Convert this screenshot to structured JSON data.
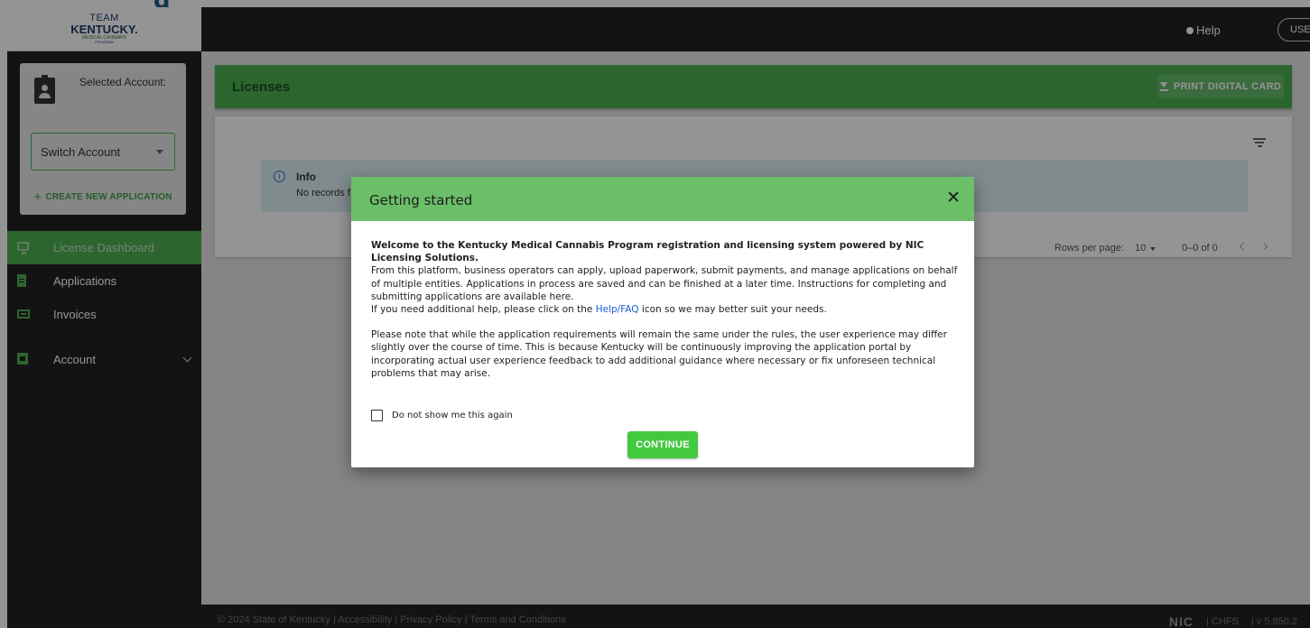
{
  "header": {
    "logo": {
      "line1": "TEAM",
      "line2": "KENTUCKY.",
      "line3": "MEDICAL CANNABIS",
      "line4": "PROGRAM"
    },
    "help_label": "Help",
    "user_label": "USER"
  },
  "sidebar": {
    "selected_account_label": "Selected Account:",
    "switch_account_label": "Switch Account",
    "create_application_label": "CREATE NEW APPLICATION",
    "items": [
      {
        "label": "License Dashboard",
        "icon": "monitor-icon",
        "active": true
      },
      {
        "label": "Applications",
        "icon": "document-icon"
      },
      {
        "label": "Invoices",
        "icon": "invoice-icon"
      },
      {
        "label": "Account",
        "icon": "account-icon",
        "expandable": true
      }
    ]
  },
  "main": {
    "title": "Licenses",
    "print_card_label": "PRINT DIGITAL CARD",
    "info": {
      "title": "Info",
      "text": "No records f"
    },
    "pagination": {
      "rows_per_page_label": "Rows per page:",
      "rows_per_page_value": "10",
      "range": "0–0 of 0"
    }
  },
  "footer": {
    "links": "© 2024 State of Kentucky  |  Accessibility  |  Privacy Policy  |  Terms and Conditions",
    "brand": "NIC",
    "chfs": "| CHFS",
    "version": "| v 5.850.2"
  },
  "modal": {
    "title": "Getting started",
    "close_label": "✕",
    "lead": "Welcome to the Kentucky Medical Cannabis Program registration and licensing system powered by NIC Licensing Solutions.",
    "para1": "From this platform, business operators can apply, upload paperwork, submit payments, and manage applications on behalf of multiple entities. Applications in process are saved and can be finished at a later time. Instructions for completing and submitting applications are available here.",
    "para2_prefix": "If you need additional help, please click on the ",
    "para2_link": "Help/FAQ",
    "para2_suffix": " icon so we may better suit your needs.",
    "para3": "Please note that while the application requirements will remain the same under the rules, the user experience may differ slightly over the course of time. This is because Kentucky will be continuously improving the application portal by incorporating actual user experience feedback to add additional guidance where necessary or fix unforeseen technical problems that may arise.",
    "checkbox_label": "Do not show me this again",
    "continue_label": "CONTINUE"
  },
  "colors": {
    "primary_green": "#4caf50",
    "modal_header_green": "#6bbf68",
    "continue_green": "#43c93f",
    "dark_bg": "#212121",
    "info_bg": "#dceff5",
    "link_blue": "#1a5fd0"
  }
}
